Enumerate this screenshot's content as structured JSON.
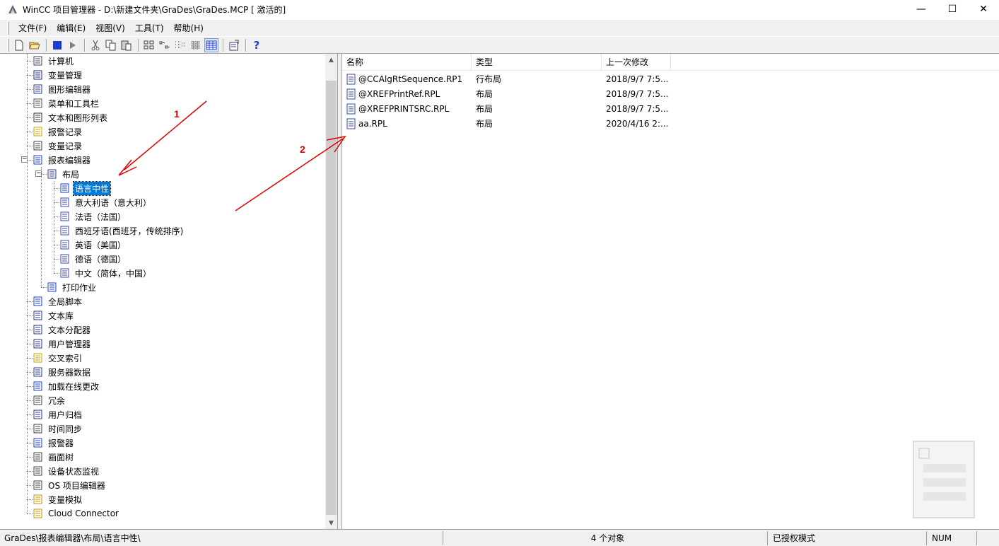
{
  "window": {
    "title": "WinCC 项目管理器 - D:\\新建文件夹\\GraDes\\GraDes.MCP [ 激活的]",
    "minimize": "—",
    "maximize": "☐",
    "close": "✕"
  },
  "menu": [
    "文件(F)",
    "编辑(E)",
    "视图(V)",
    "工具(T)",
    "帮助(H)"
  ],
  "toolbar": {
    "icons": [
      "new-icon",
      "open-icon",
      "stop-icon",
      "play-icon",
      "cut-icon",
      "copy-icon",
      "paste-icon",
      "large-icons-icon",
      "small-icons-icon",
      "list-icon",
      "details-icon",
      "properties-icon",
      "help-icon"
    ],
    "help_label": "?"
  },
  "tree": {
    "items": [
      {
        "label": "计算机",
        "icon": "computer-icon"
      },
      {
        "label": "变量管理",
        "icon": "tag-management-icon"
      },
      {
        "label": "图形编辑器",
        "icon": "graphics-designer-icon"
      },
      {
        "label": "菜单和工具栏",
        "icon": "menu-toolbar-icon"
      },
      {
        "label": "文本和图形列表",
        "icon": "text-graphic-list-icon"
      },
      {
        "label": "报警记录",
        "icon": "alarm-logging-icon"
      },
      {
        "label": "变量记录",
        "icon": "tag-logging-icon"
      },
      {
        "label": "报表编辑器",
        "icon": "report-designer-icon"
      },
      {
        "label": "布局",
        "icon": "layout-folder-icon"
      },
      {
        "label": "语言中性",
        "icon": "language-neutral-icon"
      },
      {
        "label": "意大利语（意大利）",
        "icon": "layout-icon"
      },
      {
        "label": "法语（法国）",
        "icon": "layout-icon"
      },
      {
        "label": "西班牙语(西班牙，传统排序)",
        "icon": "layout-icon"
      },
      {
        "label": "英语（美国）",
        "icon": "layout-icon"
      },
      {
        "label": "德语（德国）",
        "icon": "layout-icon"
      },
      {
        "label": "中文（简体，中国）",
        "icon": "layout-icon"
      },
      {
        "label": "打印作业",
        "icon": "print-job-icon"
      },
      {
        "label": "全局脚本",
        "icon": "global-script-icon"
      },
      {
        "label": "文本库",
        "icon": "text-library-icon"
      },
      {
        "label": "文本分配器",
        "icon": "text-distributor-icon"
      },
      {
        "label": "用户管理器",
        "icon": "user-administrator-icon"
      },
      {
        "label": "交叉索引",
        "icon": "cross-reference-icon"
      },
      {
        "label": "服务器数据",
        "icon": "server-data-icon"
      },
      {
        "label": "加载在线更改",
        "icon": "load-online-changes-icon"
      },
      {
        "label": "冗余",
        "icon": "redundancy-icon"
      },
      {
        "label": "用户归档",
        "icon": "user-archive-icon"
      },
      {
        "label": "时间同步",
        "icon": "time-sync-icon"
      },
      {
        "label": "报警器",
        "icon": "horn-icon"
      },
      {
        "label": "画面树",
        "icon": "picture-tree-icon"
      },
      {
        "label": "设备状态监视",
        "icon": "device-status-icon"
      },
      {
        "label": "OS 项目编辑器",
        "icon": "os-project-editor-icon"
      },
      {
        "label": "变量模拟",
        "icon": "tag-simulation-icon"
      },
      {
        "label": "Cloud Connector",
        "icon": "cloud-connector-icon"
      }
    ]
  },
  "list": {
    "columns": [
      "名称",
      "类型",
      "上一次修改"
    ],
    "rows": [
      {
        "name": "@CCAlgRtSequence.RP1",
        "type": "行布局",
        "modified": "2018/9/7 7:5...",
        "icon": "line-layout-icon"
      },
      {
        "name": "@XREFPrintRef.RPL",
        "type": "布局",
        "modified": "2018/9/7 7:5...",
        "icon": "layout-icon"
      },
      {
        "name": "@XREFPRINTSRC.RPL",
        "type": "布局",
        "modified": "2018/9/7 7:5...",
        "icon": "layout-icon"
      },
      {
        "name": "aa.RPL",
        "type": "布局",
        "modified": "2020/4/16 2:...",
        "icon": "layout-icon"
      }
    ]
  },
  "status": {
    "path": "GraDes\\报表编辑器\\布局\\语言中性\\",
    "count": "4 个对象",
    "mode": "已授权模式",
    "num": "NUM"
  },
  "annotations": {
    "label1": "1",
    "label2": "2",
    "color": "#e00000"
  },
  "colors": {
    "selection": "#0078d7",
    "panel_bg": "#f0f0f0"
  }
}
